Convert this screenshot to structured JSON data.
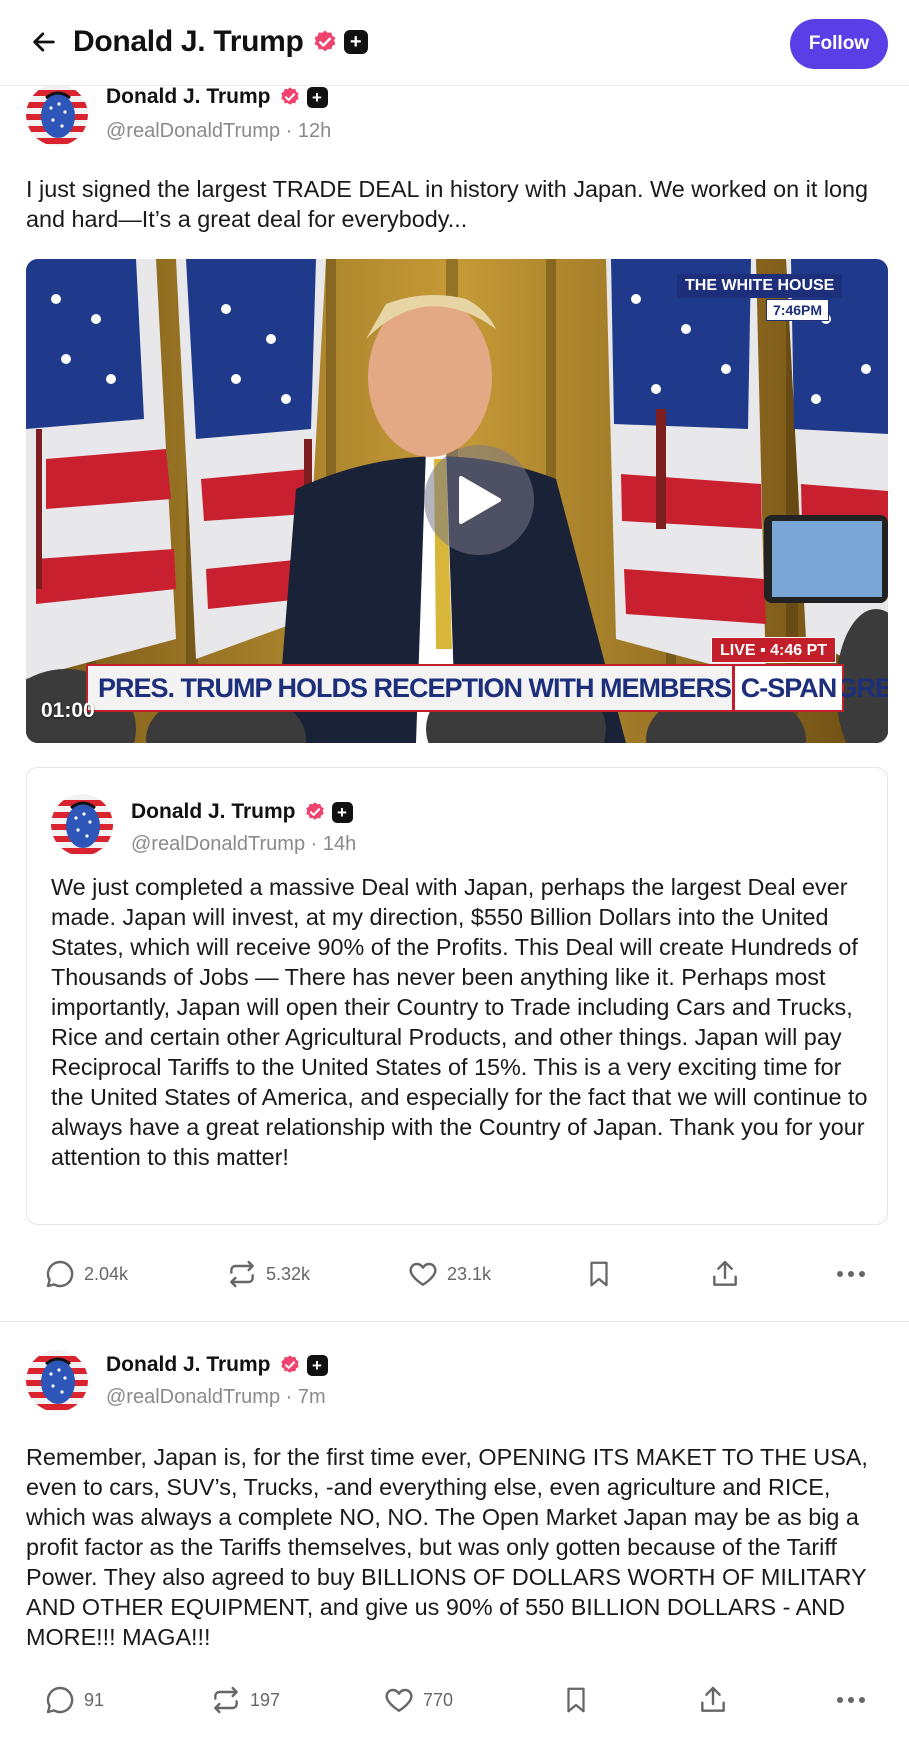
{
  "header": {
    "title": "Donald J. Trump",
    "follow_label": "Follow",
    "back_icon": "arrow-left-icon"
  },
  "colors": {
    "accent": "#5b3fe6",
    "verified": "#f0436d",
    "text_muted": "#8a8a8a"
  },
  "posts": [
    {
      "author": "Donald J. Trump",
      "handle": "@realDonaldTrump · 12h",
      "text": "I just signed the largest TRADE DEAL in history with Japan. We worked on it long and hard—It’s a great deal for everybody...",
      "video": {
        "duration": "01:00",
        "chyron": "PRES. TRUMP HOLDS RECEPTION WITH MEMBERS OF CONGRESS",
        "network": "C-SPAN",
        "live": "LIVE ▪ 4:46 PT",
        "location": "THE WHITE HOUSE",
        "local_time": "7:46PM"
      },
      "quote": {
        "author": "Donald J. Trump",
        "handle": "@realDonaldTrump · 14h",
        "text": "We just completed a massive Deal with Japan, perhaps the largest Deal ever made. Japan will invest, at my direction, $550 Billion Dollars into the United States, which will receive 90% of the Profits. This Deal will create Hundreds of Thousands of Jobs — There has never been anything like it. Perhaps most importantly, Japan will open their Country to Trade including Cars and Trucks, Rice and certain other Agricultural Products, and other things. Japan will pay Reciprocal Tariffs to the United States of 15%. This is a very exciting time for the United States of America, and especially for the fact that we will continue to always have a great relationship with the Country of Japan. Thank you for your attention to this matter!"
      },
      "stats": {
        "replies": "2.04k",
        "reposts": "5.32k",
        "likes": "23.1k"
      }
    },
    {
      "author": "Donald J. Trump",
      "handle": "@realDonaldTrump · 7m",
      "text": "Remember, Japan is, for the first time ever, OPENING ITS MAKET TO THE USA, even to cars, SUV’s, Trucks, -and everything else, even agriculture and RICE, which was always a complete NO, NO. The Open Market Japan may be as big a profit factor as the Tariffs themselves, but was only gotten because of the Tariff Power. They also agreed to buy BILLIONS OF DOLLARS WORTH OF MILITARY AND OTHER EQUIPMENT, and give us 90% of 550 BILLION DOLLARS - AND MORE!!! MAGA!!!",
      "stats": {
        "replies": "91",
        "reposts": "197",
        "likes": "770"
      }
    }
  ]
}
